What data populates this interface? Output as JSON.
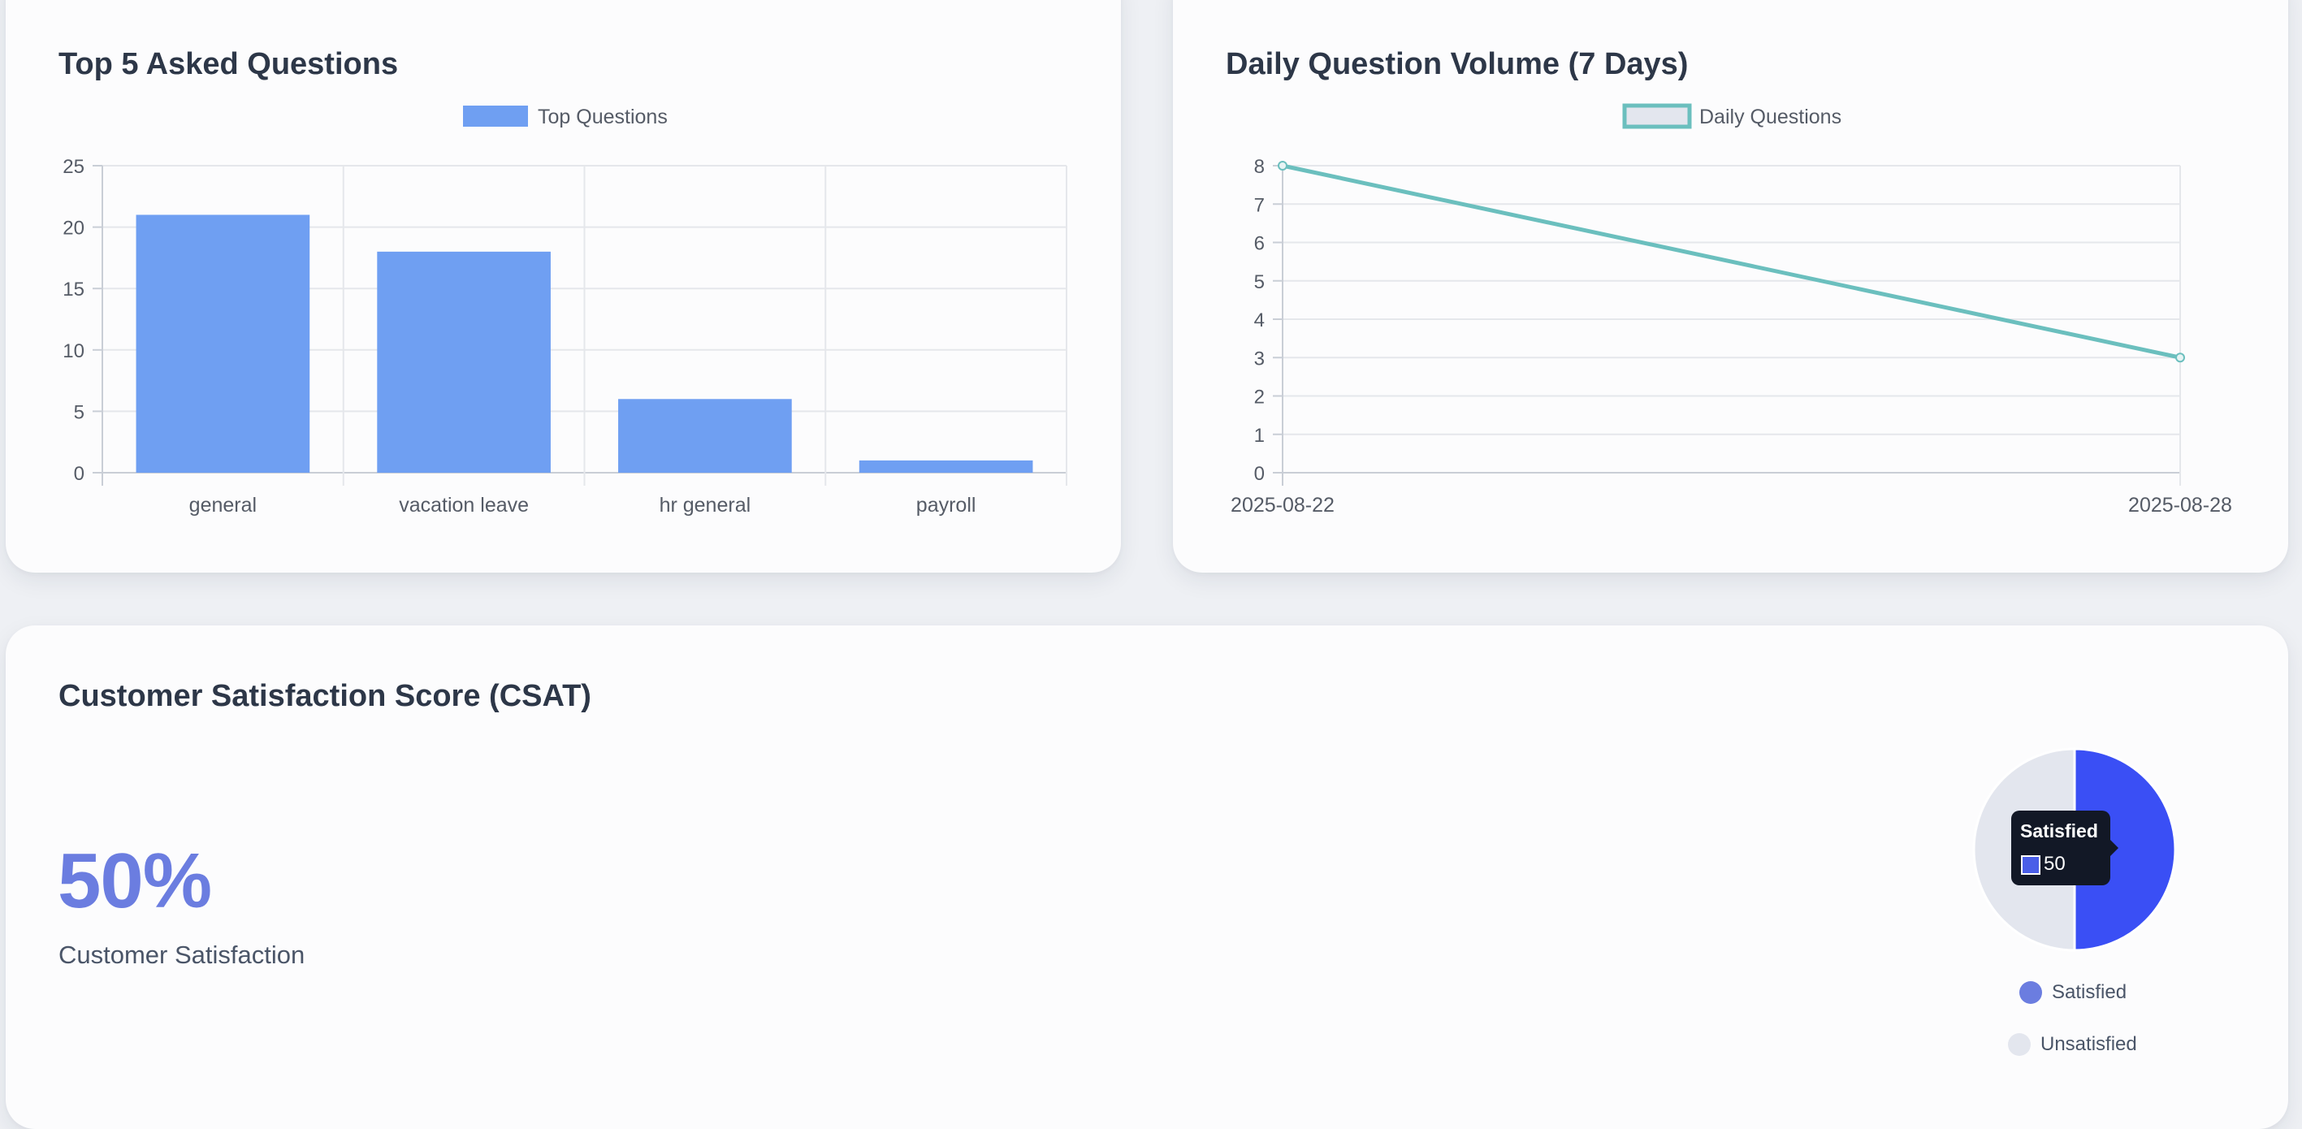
{
  "top_questions": {
    "title": "Top 5 Asked Questions",
    "chart_data": {
      "type": "bar",
      "categories": [
        "general",
        "vacation leave",
        "hr general",
        "payroll"
      ],
      "series": [
        {
          "name": "Top Questions",
          "values": [
            21,
            18,
            6,
            1
          ]
        }
      ],
      "ylim": [
        0,
        25
      ],
      "yticks": [
        0,
        5,
        10,
        15,
        20,
        25
      ],
      "grid": true,
      "legend": "top-center",
      "color": "#6f9ff2"
    }
  },
  "daily_volume": {
    "title": "Daily Question Volume (7 Days)",
    "chart_data": {
      "type": "line",
      "x": [
        "2025-08-22",
        "2025-08-28"
      ],
      "series": [
        {
          "name": "Daily Questions",
          "values": [
            8,
            3
          ]
        }
      ],
      "ylim": [
        0,
        8
      ],
      "yticks": [
        0,
        1,
        2,
        3,
        4,
        5,
        6,
        7,
        8
      ],
      "grid": true,
      "legend": "top-center",
      "color": "#6bbfbe"
    }
  },
  "csat": {
    "title": "Customer Satisfaction Score (CSAT)",
    "score": "50%",
    "caption": "Customer Satisfaction",
    "chart_data": {
      "type": "pie",
      "labels": [
        "Satisfied",
        "Unsatisfied"
      ],
      "values": [
        50,
        50
      ],
      "colors": [
        "#3a4ff5",
        "#e3e6ee"
      ],
      "legend_colors": [
        "#6b7de0",
        "#e3e6ee"
      ],
      "legend": "bottom"
    },
    "tooltip": {
      "title": "Satisfied",
      "value": "50"
    }
  }
}
